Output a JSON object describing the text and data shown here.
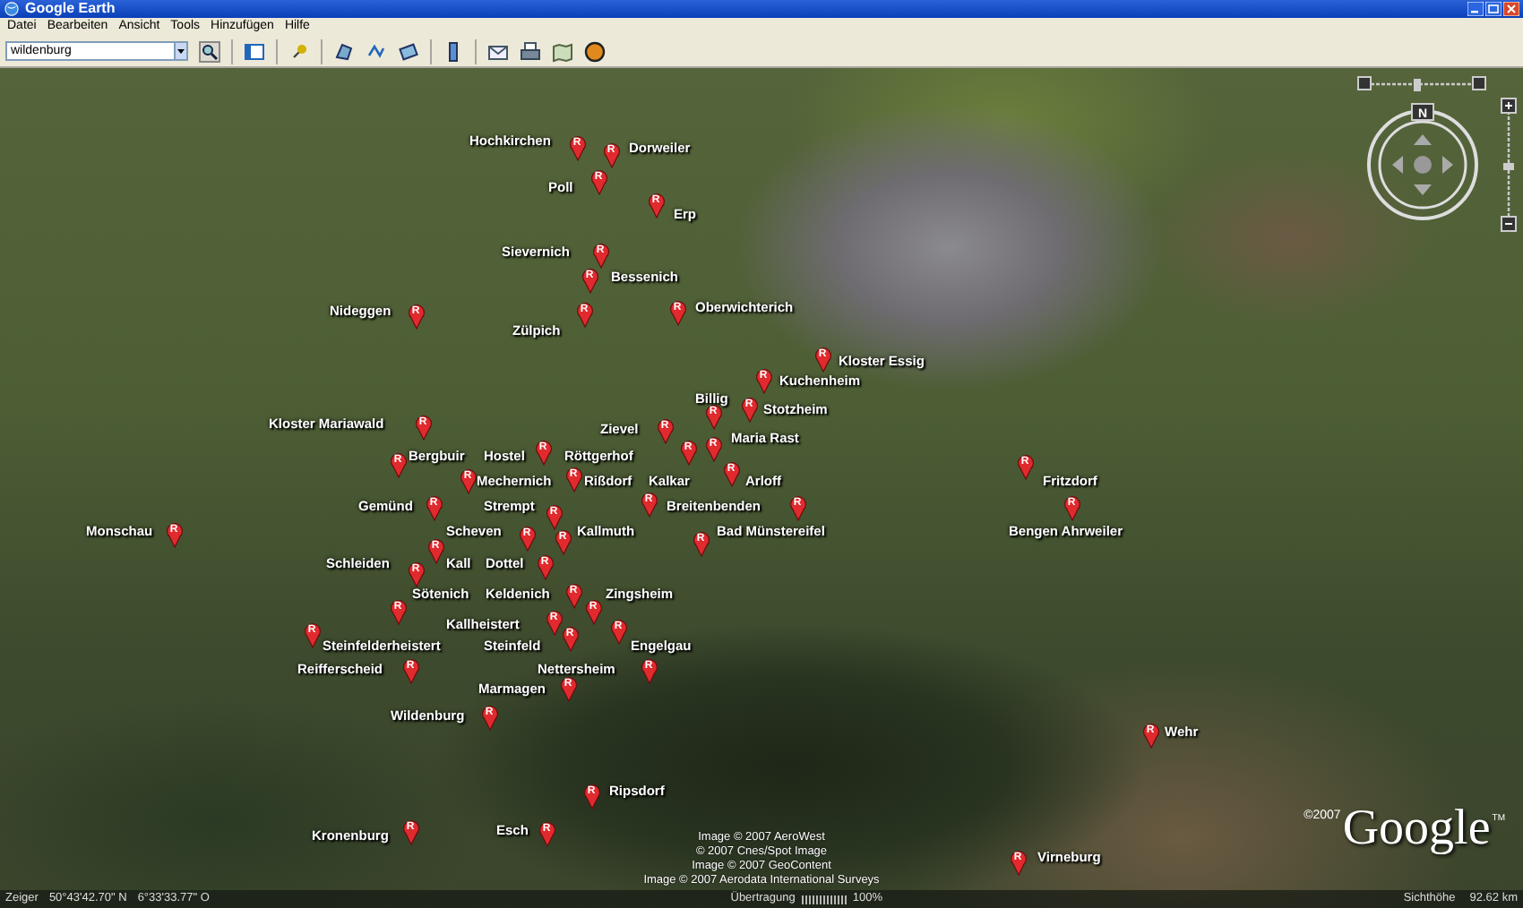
{
  "window": {
    "title": "Google Earth"
  },
  "menu": [
    "Datei",
    "Bearbeiten",
    "Ansicht",
    "Tools",
    "Hinzufügen",
    "Hilfe"
  ],
  "search": {
    "value": "wildenburg"
  },
  "placemarks": [
    {
      "label": "Hochkirchen",
      "pin_letter": "R"
    },
    {
      "label": "Dorweiler",
      "pin_letter": "R"
    },
    {
      "label": "Poll",
      "pin_letter": "R"
    },
    {
      "label": "Erp",
      "pin_letter": "R"
    },
    {
      "label": "Sievernich",
      "pin_letter": "R"
    },
    {
      "label": "Bessenich",
      "pin_letter": "R"
    },
    {
      "label": "Nideggen",
      "pin_letter": "R"
    },
    {
      "label": "Zülpich",
      "pin_letter": "R"
    },
    {
      "label": "Oberwichterich",
      "pin_letter": "R"
    },
    {
      "label": "Kloster Essig",
      "pin_letter": "R"
    },
    {
      "label": "Kuchenheim",
      "pin_letter": "R"
    },
    {
      "label": "Billig",
      "pin_letter": "R"
    },
    {
      "label": "Stotzheim",
      "pin_letter": "R"
    },
    {
      "label": "Kloster Mariawald",
      "pin_letter": "R"
    },
    {
      "label": "Zievel",
      "pin_letter": "R"
    },
    {
      "label": "Bergbuir",
      "pin_letter": "R"
    },
    {
      "label": "Hostel",
      "pin_letter": "R"
    },
    {
      "label": "Röttgerhof",
      "pin_letter": "R"
    },
    {
      "label": "Mechernich",
      "pin_letter": "R"
    },
    {
      "label": "Rißdorf",
      "pin_letter": "R"
    },
    {
      "label": "Kalkar",
      "pin_letter": "R"
    },
    {
      "label": "Maria Rast",
      "pin_letter": "R"
    },
    {
      "label": "Arloff",
      "pin_letter": "R"
    },
    {
      "label": "Fritzdorf",
      "pin_letter": "R"
    },
    {
      "label": "Gemünd",
      "pin_letter": "R"
    },
    {
      "label": "Strempt",
      "pin_letter": "R"
    },
    {
      "label": "Breitenbenden",
      "pin_letter": "R"
    },
    {
      "label": "Monschau",
      "pin_letter": "R"
    },
    {
      "label": "Scheven",
      "pin_letter": "R"
    },
    {
      "label": "Kallmuth",
      "pin_letter": "R"
    },
    {
      "label": "Bad Münstereifel",
      "pin_letter": "R"
    },
    {
      "label": "Bengen Ahrweiler",
      "pin_letter": "R"
    },
    {
      "label": "Schleiden",
      "pin_letter": "R"
    },
    {
      "label": "Kall",
      "pin_letter": "R"
    },
    {
      "label": "Dottel",
      "pin_letter": "R"
    },
    {
      "label": "Sötenich",
      "pin_letter": "R"
    },
    {
      "label": "Keldenich",
      "pin_letter": "R"
    },
    {
      "label": "Zingsheim",
      "pin_letter": "R"
    },
    {
      "label": "Kallheistert",
      "pin_letter": "R"
    },
    {
      "label": "Steinfelderheistert",
      "pin_letter": "R"
    },
    {
      "label": "Steinfeld",
      "pin_letter": "R"
    },
    {
      "label": "Engelgau",
      "pin_letter": "R"
    },
    {
      "label": "Reifferscheid",
      "pin_letter": "R"
    },
    {
      "label": "Nettersheim",
      "pin_letter": "R"
    },
    {
      "label": "Marmagen",
      "pin_letter": "R"
    },
    {
      "label": "Wildenburg",
      "pin_letter": "R"
    },
    {
      "label": "Wehr",
      "pin_letter": "R"
    },
    {
      "label": "Ripsdorf",
      "pin_letter": "R"
    },
    {
      "label": "Kronenburg",
      "pin_letter": "R"
    },
    {
      "label": "Esch",
      "pin_letter": "R"
    },
    {
      "label": "Virneburg",
      "pin_letter": "R"
    }
  ],
  "compass": {
    "north_label": "N"
  },
  "attribution": [
    "Image © 2007 AeroWest",
    "© 2007 Cnes/Spot Image",
    "Image © 2007 GeoContent",
    "Image © 2007 Aerodata International Surveys"
  ],
  "logo": {
    "copyright": "©2007",
    "text": "Google",
    "mark": "TM"
  },
  "status_bar": {
    "pointer_label": "Zeiger",
    "latitude": "50°43'42.70\" N",
    "longitude": "6°33'33.77\" O",
    "streaming_label": "Übertragung",
    "streaming_reading": "100%",
    "altitude_label": "Sichthöhe",
    "altitude": "92.62 km"
  }
}
